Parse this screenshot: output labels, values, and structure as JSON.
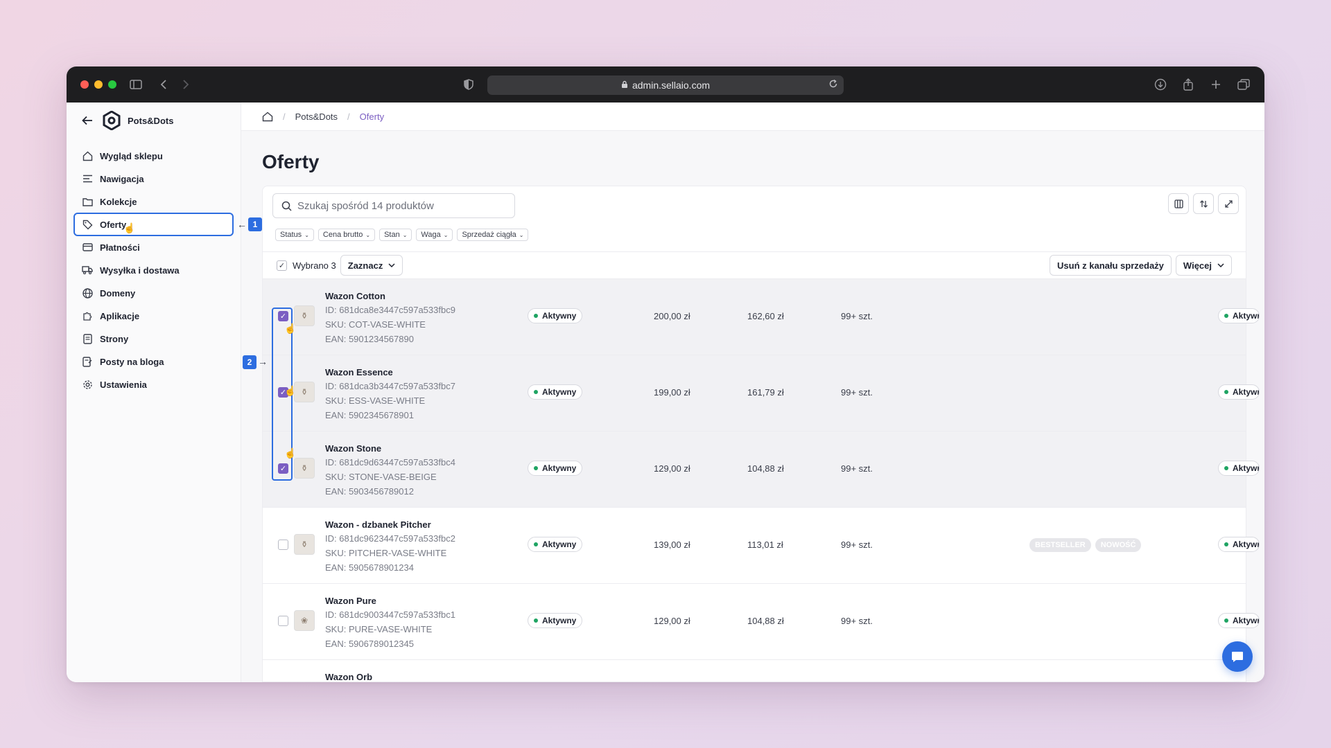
{
  "browser": {
    "url": "admin.sellaio.com"
  },
  "brand": {
    "name": "Pots&Dots"
  },
  "sidebar": {
    "items": [
      {
        "label": "Wygląd sklepu",
        "icon": "home-icon"
      },
      {
        "label": "Nawigacja",
        "icon": "menu-lines-icon"
      },
      {
        "label": "Kolekcje",
        "icon": "folder-icon"
      },
      {
        "label": "Oferty",
        "icon": "tag-icon"
      },
      {
        "label": "Płatności",
        "icon": "card-icon"
      },
      {
        "label": "Wysyłka i dostawa",
        "icon": "truck-icon"
      },
      {
        "label": "Domeny",
        "icon": "globe-icon"
      },
      {
        "label": "Aplikacje",
        "icon": "puzzle-icon"
      },
      {
        "label": "Strony",
        "icon": "page-icon"
      },
      {
        "label": "Posty na bloga",
        "icon": "blog-icon"
      },
      {
        "label": "Ustawienia",
        "icon": "gear-icon"
      }
    ]
  },
  "breadcrumb": {
    "shop": "Pots&Dots",
    "current": "Oferty"
  },
  "page": {
    "title": "Oferty"
  },
  "search": {
    "placeholder": "Szukaj spośród 14 produktów"
  },
  "filters": [
    "Status",
    "Cena brutto",
    "Stan",
    "Waga",
    "Sprzedaż ciągła"
  ],
  "selection": {
    "label": "Wybrano 3",
    "select_button": "Zaznacz",
    "remove_button": "Usuń z kanału sprzedaży",
    "more_button": "Więcej"
  },
  "products": [
    {
      "name": "Wazon Cotton",
      "id": "ID: 681dca8e3447c597a533fbc9",
      "sku": "SKU: COT-VASE-WHITE",
      "ean": "EAN: 5901234567890",
      "status": "Aktywny",
      "price": "200,00 zł",
      "net": "162,60 zł",
      "stock": "99+ szt.",
      "status2": "Aktywny",
      "checked": true
    },
    {
      "name": "Wazon Essence",
      "id": "ID: 681dca3b3447c597a533fbc7",
      "sku": "SKU: ESS-VASE-WHITE",
      "ean": "EAN: 5902345678901",
      "status": "Aktywny",
      "price": "199,00 zł",
      "net": "161,79 zł",
      "stock": "99+ szt.",
      "status2": "Aktywny",
      "checked": true
    },
    {
      "name": "Wazon Stone",
      "id": "ID: 681dc9d63447c597a533fbc4",
      "sku": "SKU: STONE-VASE-BEIGE",
      "ean": "EAN: 5903456789012",
      "status": "Aktywny",
      "price": "129,00 zł",
      "net": "104,88 zł",
      "stock": "99+ szt.",
      "status2": "Aktywny",
      "checked": true
    },
    {
      "name": "Wazon - dzbanek Pitcher",
      "id": "ID: 681dc9623447c597a533fbc2",
      "sku": "SKU: PITCHER-VASE-WHITE",
      "ean": "EAN: 5905678901234",
      "status": "Aktywny",
      "price": "139,00 zł",
      "net": "113,01 zł",
      "stock": "99+ szt.",
      "tags": [
        "BESTSELLER",
        "NOWOŚĆ"
      ],
      "status2": "Aktywny",
      "checked": false
    },
    {
      "name": "Wazon Pure",
      "id": "ID: 681dc9003447c597a533fbc1",
      "sku": "SKU: PURE-VASE-WHITE",
      "ean": "EAN: 5906789012345",
      "status": "Aktywny",
      "price": "129,00 zł",
      "net": "104,88 zł",
      "stock": "99+ szt.",
      "status2": "Aktywny",
      "checked": false
    },
    {
      "name": "Wazon Orb"
    }
  ],
  "annotations": {
    "marker1": "1",
    "marker2": "2"
  },
  "colors": {
    "accent": "#7b5ec2",
    "highlight": "#2d6de0",
    "active_dot": "#1fa463"
  }
}
